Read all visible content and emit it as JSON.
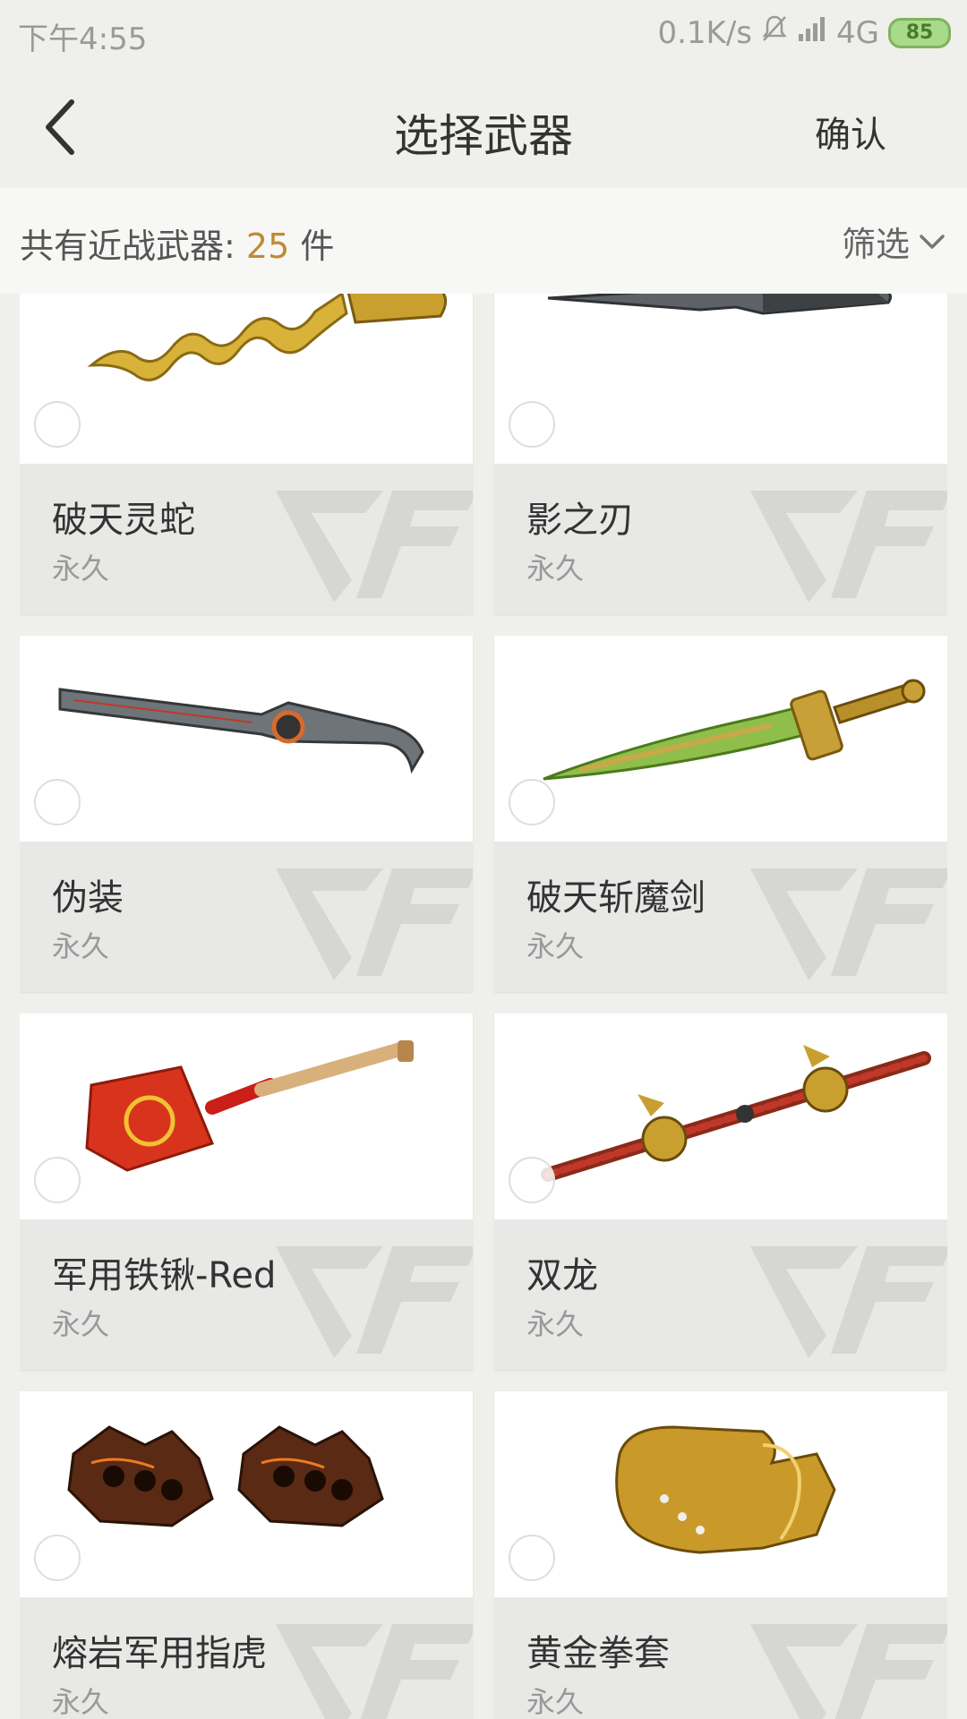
{
  "status_bar": {
    "time": "下午4:55",
    "network_speed": "0.1K/s",
    "network_type": "4G",
    "battery": "85"
  },
  "nav": {
    "title": "选择武器",
    "confirm_label": "确认"
  },
  "summary": {
    "count_label": "共有近战武器:",
    "count_value": "25",
    "count_unit": "件",
    "filter_label": "筛选"
  },
  "weapons": [
    {
      "name": "破天灵蛇",
      "duration": "永久",
      "icon": "golden-serpent-blade"
    },
    {
      "name": "影之刃",
      "duration": "永久",
      "icon": "dark-knife"
    },
    {
      "name": "伪装",
      "duration": "永久",
      "icon": "hooked-machete"
    },
    {
      "name": "破天斩魔剑",
      "duration": "永久",
      "icon": "golden-green-sword"
    },
    {
      "name": "军用铁锹-Red",
      "duration": "永久",
      "icon": "red-shovel"
    },
    {
      "name": "双龙",
      "duration": "永久",
      "icon": "double-dragon-staff"
    },
    {
      "name": "熔岩军用指虎",
      "duration": "永久",
      "icon": "lava-knuckles"
    },
    {
      "name": "黄金拳套",
      "duration": "永久",
      "icon": "golden-gauntlet"
    }
  ],
  "colors": {
    "accent": "#c08a35",
    "background": "#efefec",
    "card_info_bg": "#e8e8e6"
  }
}
